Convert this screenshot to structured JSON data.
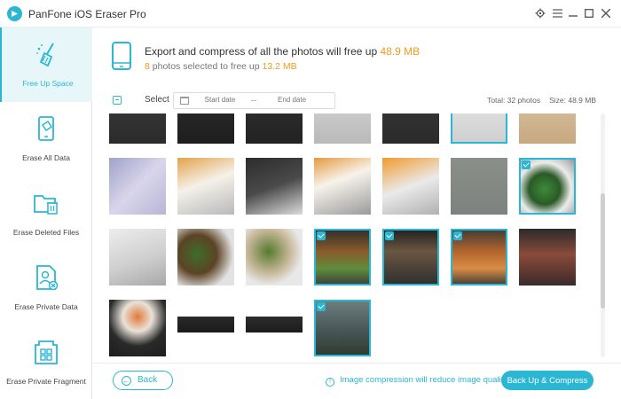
{
  "app": {
    "title": "PanFone iOS Eraser Pro"
  },
  "window_controls": {
    "settings": "gear-icon",
    "menu": "menu-icon",
    "minimize": "minimize-icon",
    "maximize": "maximize-icon",
    "close": "close-icon"
  },
  "sidebar": {
    "items": [
      {
        "label": "Free Up Space",
        "icon": "broom-icon",
        "active": true
      },
      {
        "label": "Erase All Data",
        "icon": "phone-erase-icon",
        "active": false
      },
      {
        "label": "Erase Deleted Files",
        "icon": "folder-trash-icon",
        "active": false
      },
      {
        "label": "Erase Private Data",
        "icon": "private-file-icon",
        "active": false
      },
      {
        "label": "Erase Private Fragment",
        "icon": "fragment-icon",
        "active": false
      }
    ]
  },
  "header": {
    "line1_prefix": "Export and compress of all the photos will free up ",
    "line1_value": "48.9 MB",
    "line2_count": "8",
    "line2_text": " photos selected to free up ",
    "line2_value": "13.2 MB"
  },
  "filter": {
    "select_label": "Select",
    "start_placeholder": "Start date",
    "separator": "--",
    "end_placeholder": "End date",
    "total": "Total: 32 photos",
    "size": "Size: 48.9 MB"
  },
  "photos": [
    {
      "selected": false
    },
    {
      "selected": false
    },
    {
      "selected": false
    },
    {
      "selected": false
    },
    {
      "selected": false
    },
    {
      "selected": true
    },
    {
      "selected": false
    },
    {
      "selected": false
    },
    {
      "selected": false
    },
    {
      "selected": false
    },
    {
      "selected": false
    },
    {
      "selected": false
    },
    {
      "selected": false
    },
    {
      "selected": true
    },
    {
      "selected": false
    },
    {
      "selected": false
    },
    {
      "selected": false
    },
    {
      "selected": true
    },
    {
      "selected": true
    },
    {
      "selected": true
    },
    {
      "selected": false
    },
    {
      "selected": false
    },
    {
      "selected": false
    },
    {
      "selected": false
    },
    {
      "selected": true
    }
  ],
  "footer": {
    "back_label": "Back",
    "note": "Image compression will reduce image quality",
    "primary_label": "Back Up & Compress"
  },
  "colors": {
    "accent": "#2bb7d3",
    "highlight": "#f39a1e"
  }
}
